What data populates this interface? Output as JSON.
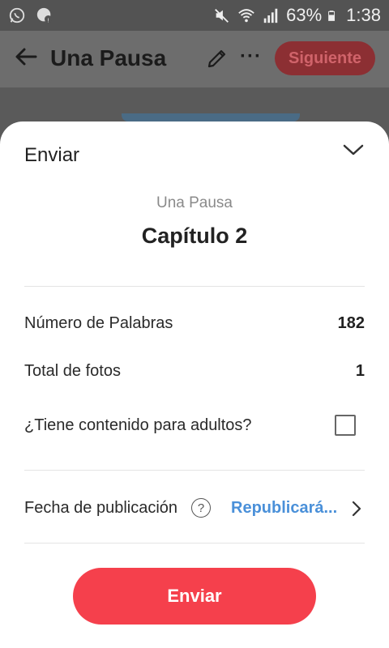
{
  "statusbar": {
    "battery": "63%",
    "time": "1:38",
    "icons": [
      "whatsapp-icon",
      "messenger-icon",
      "mute-icon",
      "wifi-icon",
      "signal-icon",
      "battery-icon"
    ]
  },
  "appbar": {
    "title": "Una Pausa",
    "next_label": "Siguiente",
    "more_label": "···"
  },
  "sheet": {
    "title": "Enviar",
    "story_name": "Una Pausa",
    "chapter_name": "Capítulo 2",
    "word_count_label": "Número de Palabras",
    "word_count": "182",
    "photos_label": "Total de fotos",
    "photos_count": "1",
    "mature_label": "¿Tiene contenido para adultos?",
    "mature_checked": false,
    "pub_date_label": "Fecha de publicación",
    "help_symbol": "?",
    "pub_date_value": "Republicará...",
    "send_label": "Enviar"
  },
  "colors": {
    "accent": "#f5404c",
    "link": "#4a90d9"
  }
}
